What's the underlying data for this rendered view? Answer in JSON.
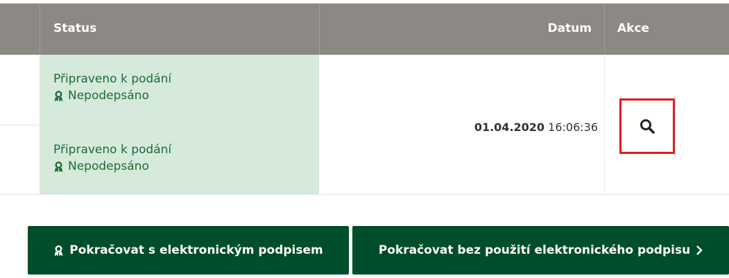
{
  "table": {
    "headers": {
      "status": "Status",
      "datum": "Datum",
      "akce": "Akce"
    },
    "rows": [
      {
        "status": "Připraveno k podání",
        "signature": "Nepodepsáno"
      },
      {
        "status": "Připraveno k podání",
        "signature": "Nepodepsáno"
      }
    ],
    "date_bold": "01.04.2020",
    "time": "16:06:36",
    "action_icon": "search-icon"
  },
  "buttons": {
    "sign_label": "Pokračovat s elektronickým podpisem",
    "nosign_label": "Pokračovat bez použití elektronického podpisu",
    "sign_icon": "award-icon",
    "nosign_icon": "chevron-right-icon"
  },
  "colors": {
    "header_bg": "#8c8883",
    "status_bg": "#d5eadb",
    "status_text": "#1e6b35",
    "button_bg": "#004d2a",
    "highlight_border": "#e2191c"
  }
}
